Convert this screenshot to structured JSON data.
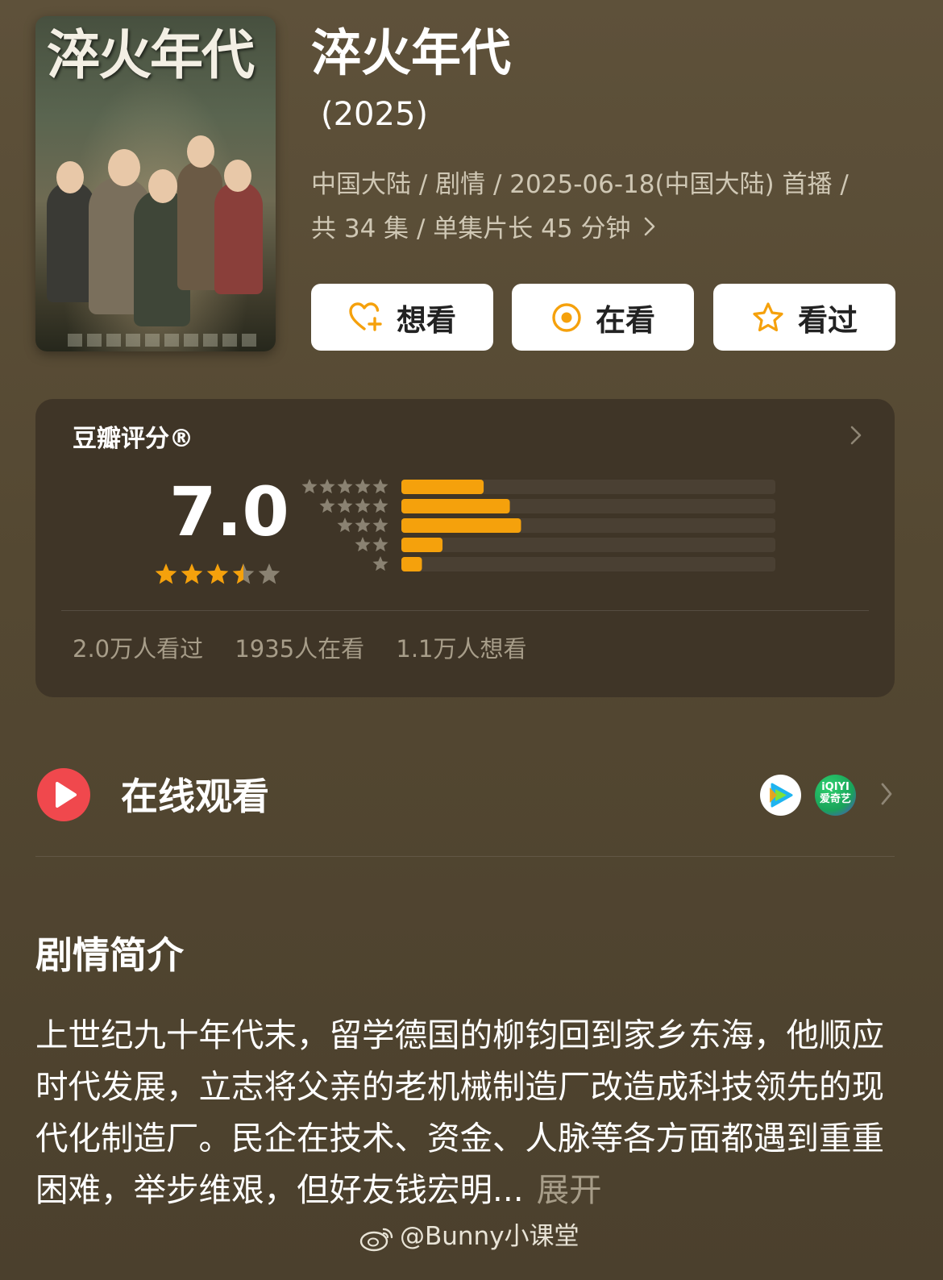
{
  "poster": {
    "title_text": "淬火年代"
  },
  "show": {
    "title": "淬火年代",
    "year": " (2025)",
    "meta_line1": "中国大陆 / 剧情 / 2025-06-18(中国大陆) 首播 /",
    "meta_line2": "共 34 集 / 单集片长 45 分钟"
  },
  "actions": [
    {
      "label": "想看",
      "icon": "heart-plus-icon"
    },
    {
      "label": "在看",
      "icon": "target-circle-icon"
    },
    {
      "label": "看过",
      "icon": "star-outline-icon"
    }
  ],
  "rating": {
    "title": "豆瓣评分®",
    "score": "7.0",
    "stars": 3.5,
    "distribution": [
      {
        "stars": 5,
        "fraction": 0.22
      },
      {
        "stars": 4,
        "fraction": 0.29
      },
      {
        "stars": 3,
        "fraction": 0.32
      },
      {
        "stars": 2,
        "fraction": 0.11
      },
      {
        "stars": 1,
        "fraction": 0.055
      }
    ],
    "counts": [
      "2.0万人看过",
      "1935人在看",
      "1.1万人想看"
    ]
  },
  "online": {
    "label": "在线观看",
    "platforms": [
      {
        "name": "tencent-video-icon"
      },
      {
        "name": "iqiyi-icon",
        "text_top": "iQIYI",
        "text_bottom": "爱奇艺"
      }
    ]
  },
  "synopsis": {
    "title": "剧情简介",
    "text": "上世纪九十年代末，留学德国的柳钧回到家乡东海，他顺应时代发展，立志将父亲的老机械制造厂改造成科技领先的现代化制造厂。民企在技术、资金、人脉等各方面都遇到重重困难，举步维艰，但好友钱宏明...",
    "expand": "展开"
  },
  "watermark": "@Bunny小课堂",
  "colors": {
    "accent_orange": "#f5a10c",
    "star_gray": "#8a8272",
    "play_red": "#f0484d"
  }
}
